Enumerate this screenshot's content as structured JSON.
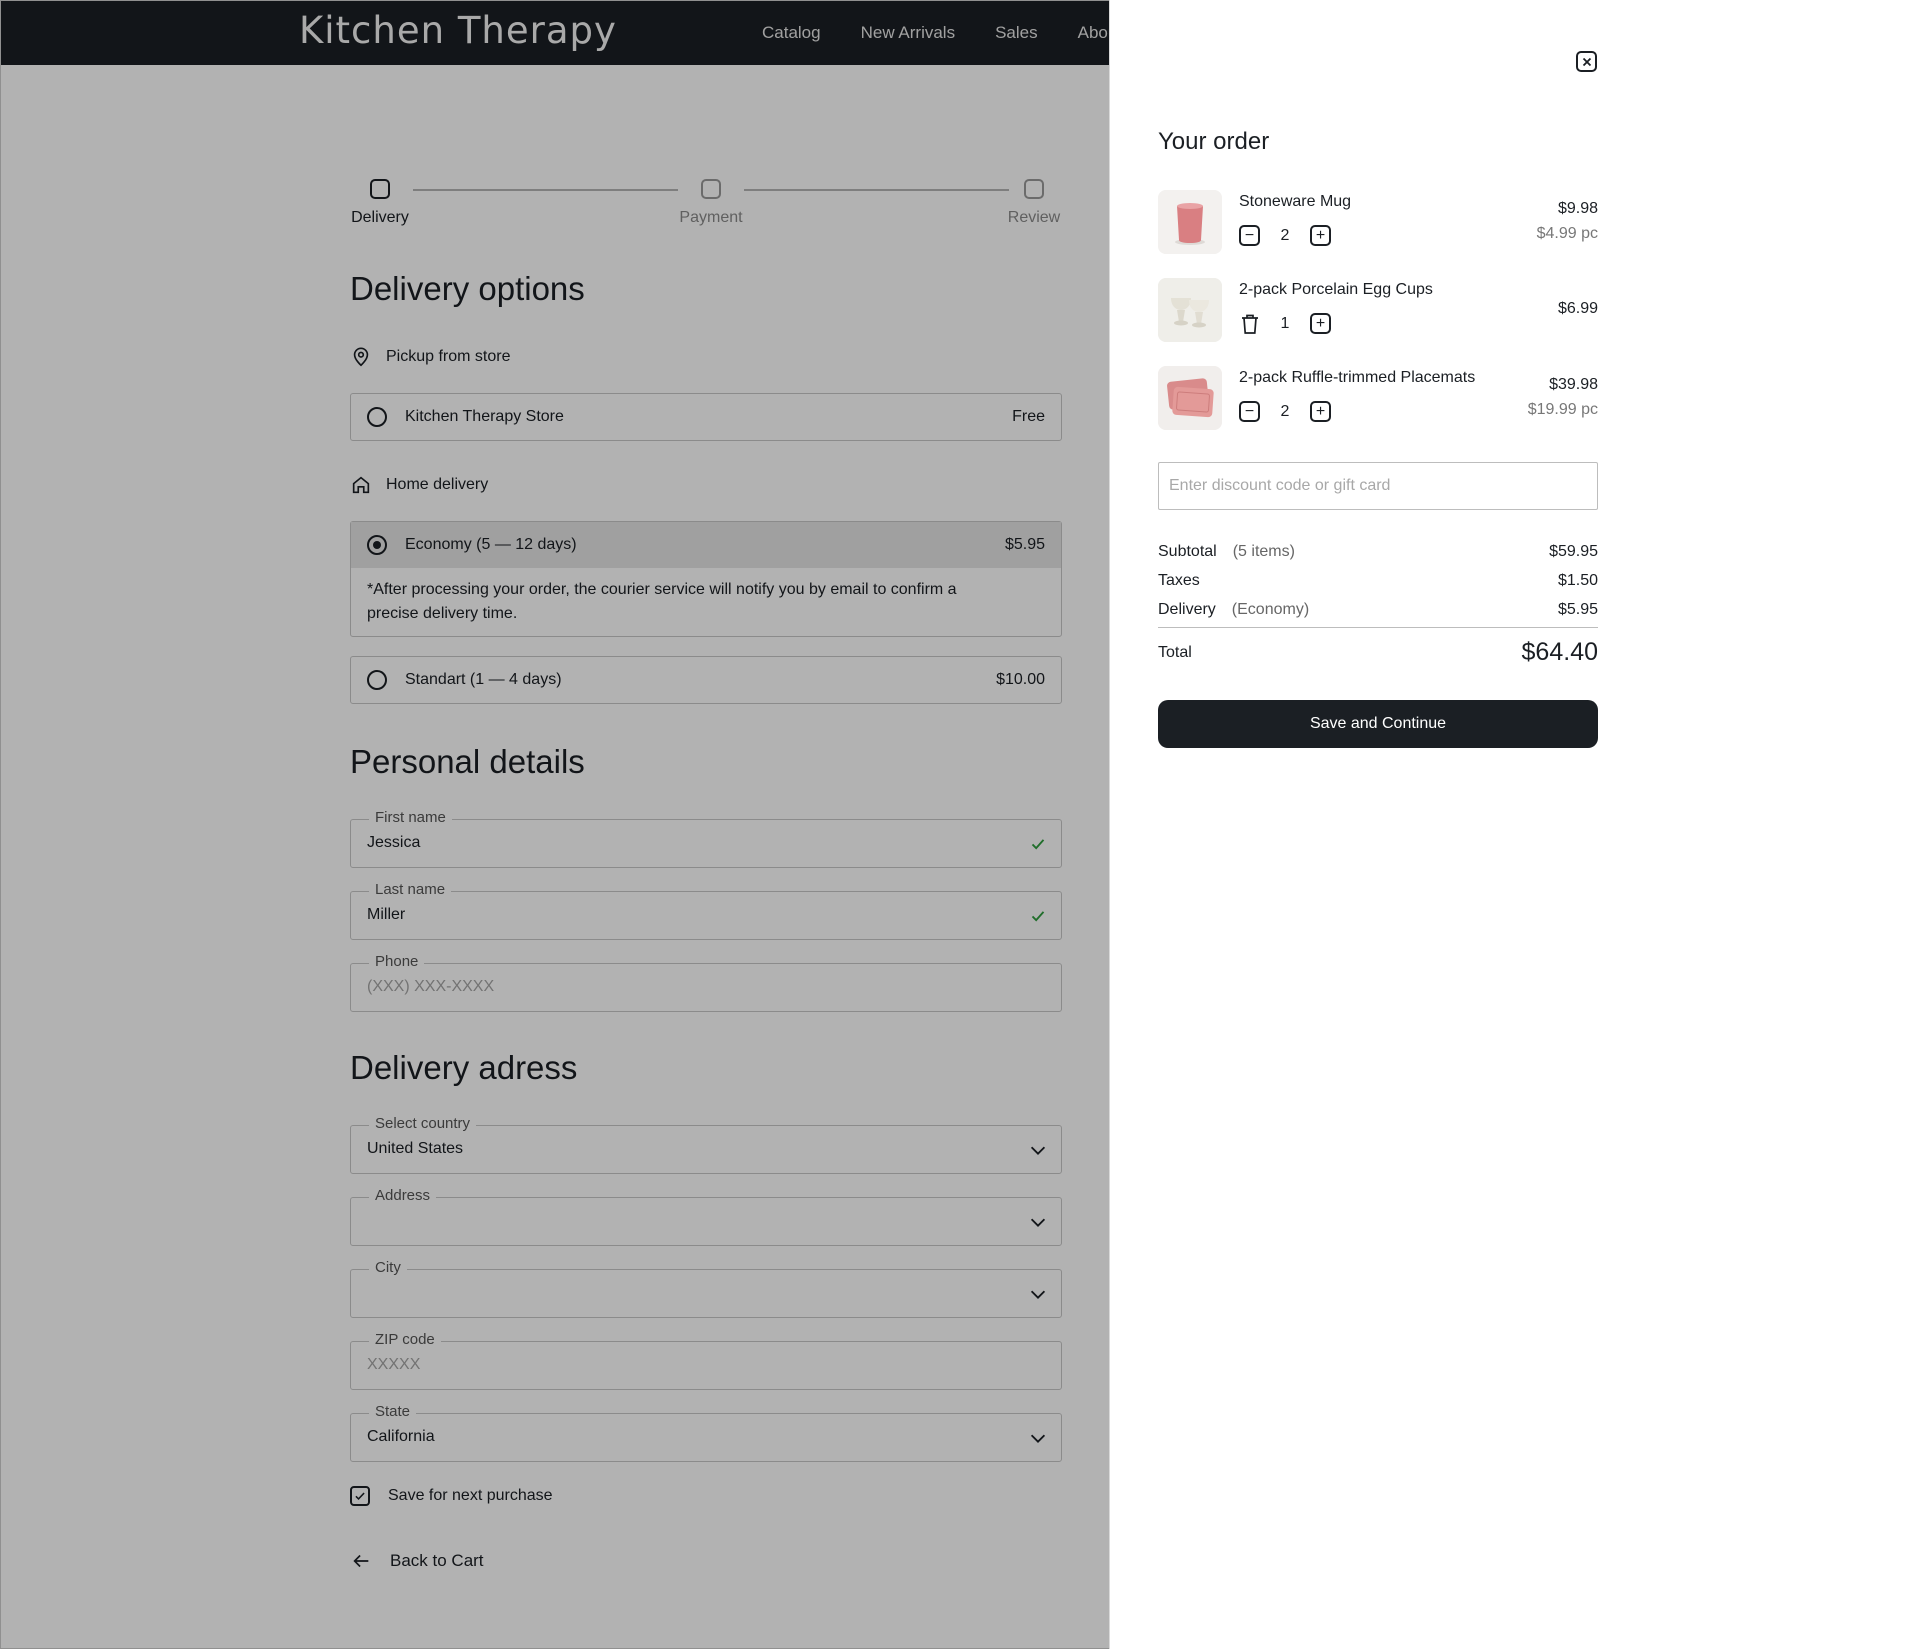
{
  "header": {
    "logo": "Kitchen Therapy",
    "nav": [
      "Catalog",
      "New Arrivals",
      "Sales",
      "About"
    ]
  },
  "stepper": {
    "steps": [
      "Delivery",
      "Payment",
      "Review"
    ]
  },
  "delivery_options": {
    "title": "Delivery options",
    "pickup_label": "Pickup from store",
    "store": {
      "name": "Kitchen Therapy Store",
      "price": "Free"
    },
    "home_label": "Home delivery",
    "economy": {
      "name": "Economy (5 — 12 days)",
      "price": "$5.95",
      "note": "*After processing your order, the courier service will notify you by email to confirm a precise delivery time."
    },
    "standard": {
      "name": "Standart (1 — 4 days)",
      "price": "$10.00"
    }
  },
  "personal_details": {
    "title": "Personal details",
    "first_name": {
      "label": "First name",
      "value": "Jessica"
    },
    "last_name": {
      "label": "Last name",
      "value": "Miller"
    },
    "phone": {
      "label": "Phone",
      "placeholder": "(XXX) XXX-XXXX"
    }
  },
  "delivery_address": {
    "title": "Delivery adress",
    "country": {
      "label": "Select country",
      "value": "United States"
    },
    "address": {
      "label": "Address",
      "value": ""
    },
    "city": {
      "label": "City",
      "value": ""
    },
    "zip": {
      "label": "ZIP code",
      "placeholder": "XXXXX"
    },
    "state": {
      "label": "State",
      "value": "California"
    },
    "save_label": "Save for next purchase",
    "back_label": "Back to Cart"
  },
  "order": {
    "title": "Your order",
    "items": [
      {
        "name": "Stoneware Mug",
        "qty": "2",
        "price": "$9.98",
        "unit": "$4.99 pc"
      },
      {
        "name": "2-pack Porcelain Egg Cups",
        "qty": "1",
        "price": "$6.99",
        "unit": ""
      },
      {
        "name": "2-pack Ruffle-trimmed Placemats",
        "qty": "2",
        "price": "$39.98",
        "unit": "$19.99 pc"
      }
    ],
    "discount_placeholder": "Enter discount code or gift card",
    "subtotal": {
      "label": "Subtotal",
      "note": "(5 items)",
      "value": "$59.95"
    },
    "taxes": {
      "label": "Taxes",
      "value": "$1.50"
    },
    "delivery": {
      "label": "Delivery",
      "note": "(Economy)",
      "value": "$5.95"
    },
    "total": {
      "label": "Total",
      "value": "$64.40"
    },
    "cta": "Save and Continue"
  },
  "colors": {
    "dark": "#1b1f24",
    "check_green": "#2e9e3e",
    "overlay": "rgba(0,0,0,0.30)"
  }
}
